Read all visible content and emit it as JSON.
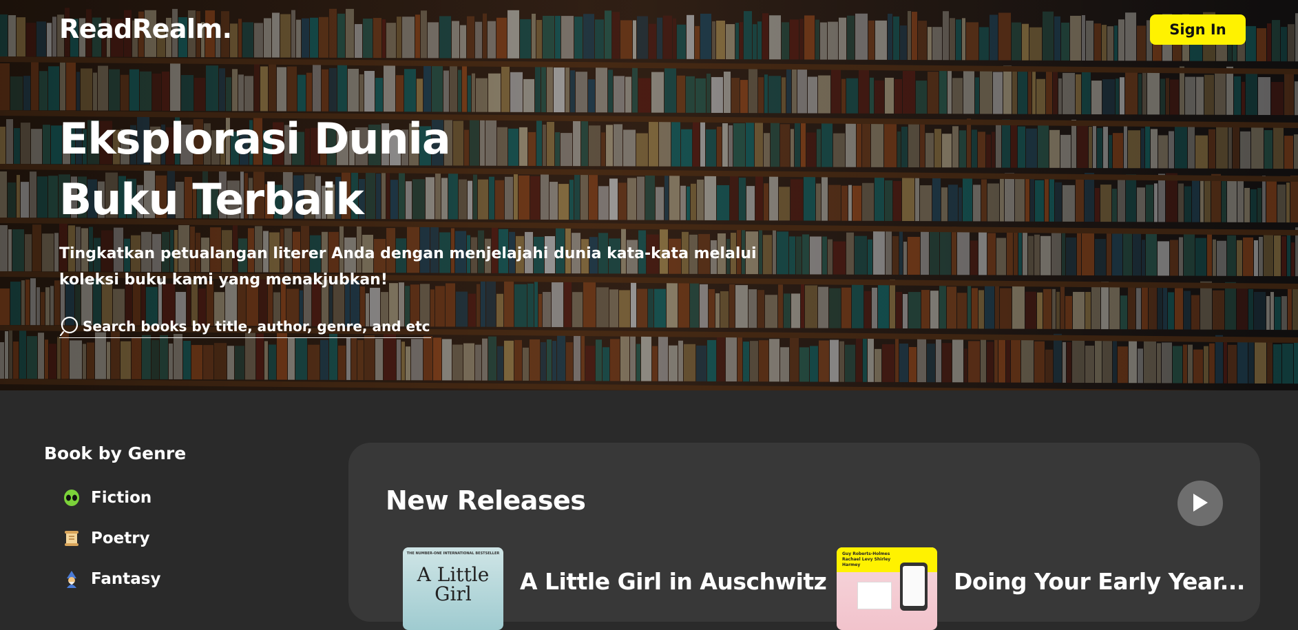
{
  "header": {
    "logo": "ReadRealm.",
    "signin_label": "Sign In"
  },
  "hero": {
    "title_line1": "Eksplorasi Dunia",
    "title_line2": "Buku Terbaik",
    "subtitle_line1": "Tingkatkan petualangan literer Anda dengan menjelajahi dunia kata-kata melalui",
    "subtitle_line2": "koleksi buku kami yang menakjubkan!",
    "search_placeholder": "Search books by title, author, genre, and etc..."
  },
  "sidebar": {
    "title": "Book by Genre",
    "items": [
      {
        "label": "Fiction",
        "icon": "alien-icon"
      },
      {
        "label": "Poetry",
        "icon": "scroll-icon"
      },
      {
        "label": "Fantasy",
        "icon": "mage-icon"
      }
    ]
  },
  "new_releases": {
    "title": "New Releases",
    "books": [
      {
        "title": "A Little Girl in Auschwitz",
        "cover_top": "THE NUMBER-ONE INTERNATIONAL BESTSELLER",
        "cover_text": "A Little Girl"
      },
      {
        "title": "Doing Your Early Year...",
        "cover_top": "Guy Roberts-Holmes  Rachael Levy  Shirley Harmey"
      }
    ]
  },
  "colors": {
    "accent": "#fff200",
    "background": "#2a2a2a",
    "panel": "#383838"
  }
}
